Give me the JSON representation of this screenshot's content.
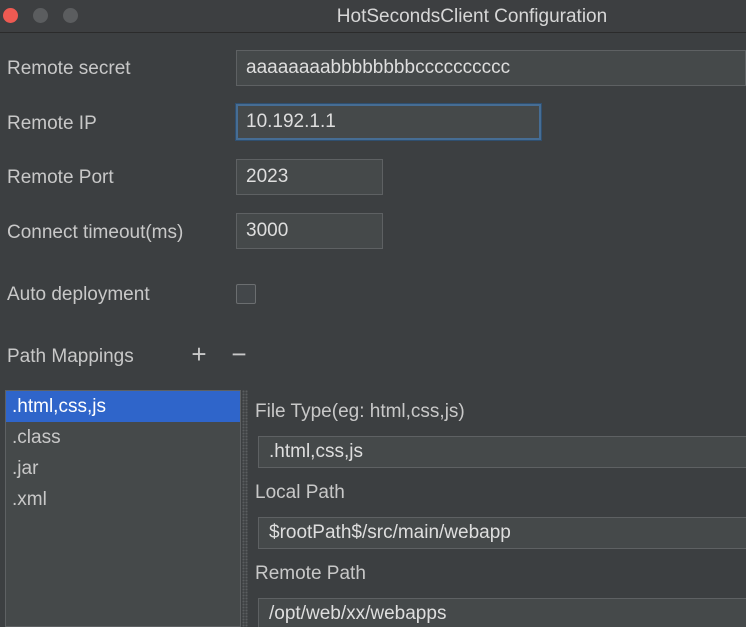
{
  "window": {
    "title": "HotSecondsClient Configuration"
  },
  "form": {
    "remote_secret_label": "Remote secret",
    "remote_secret_value": "aaaaaaaabbbbbbbbcccccccccc",
    "remote_ip_label": "Remote IP",
    "remote_ip_value": "10.192.1.1",
    "remote_port_label": "Remote Port",
    "remote_port_value": "2023",
    "connect_timeout_label": "Connect timeout(ms)",
    "connect_timeout_value": "3000",
    "auto_deployment_label": "Auto deployment",
    "auto_deployment_checked": false
  },
  "path_mappings": {
    "label": "Path Mappings",
    "add_icon": "+",
    "remove_icon": "−",
    "items": [
      {
        "label": ".html,css,js",
        "selected": true
      },
      {
        "label": ".class",
        "selected": false
      },
      {
        "label": ".jar",
        "selected": false
      },
      {
        "label": ".xml",
        "selected": false
      }
    ],
    "detail": {
      "file_type_label": "File Type(eg: html,css,js)",
      "file_type_value": ".html,css,js",
      "local_path_label": "Local Path",
      "local_path_value": "$rootPath$/src/main/webapp",
      "remote_path_label": "Remote Path",
      "remote_path_value": "/opt/web/xx/webapps"
    }
  },
  "colors": {
    "background": "#3c3f41",
    "field": "#45494a",
    "selection": "#2f65ca",
    "focus_border": "#466d94",
    "close_button": "#ee5a52"
  }
}
